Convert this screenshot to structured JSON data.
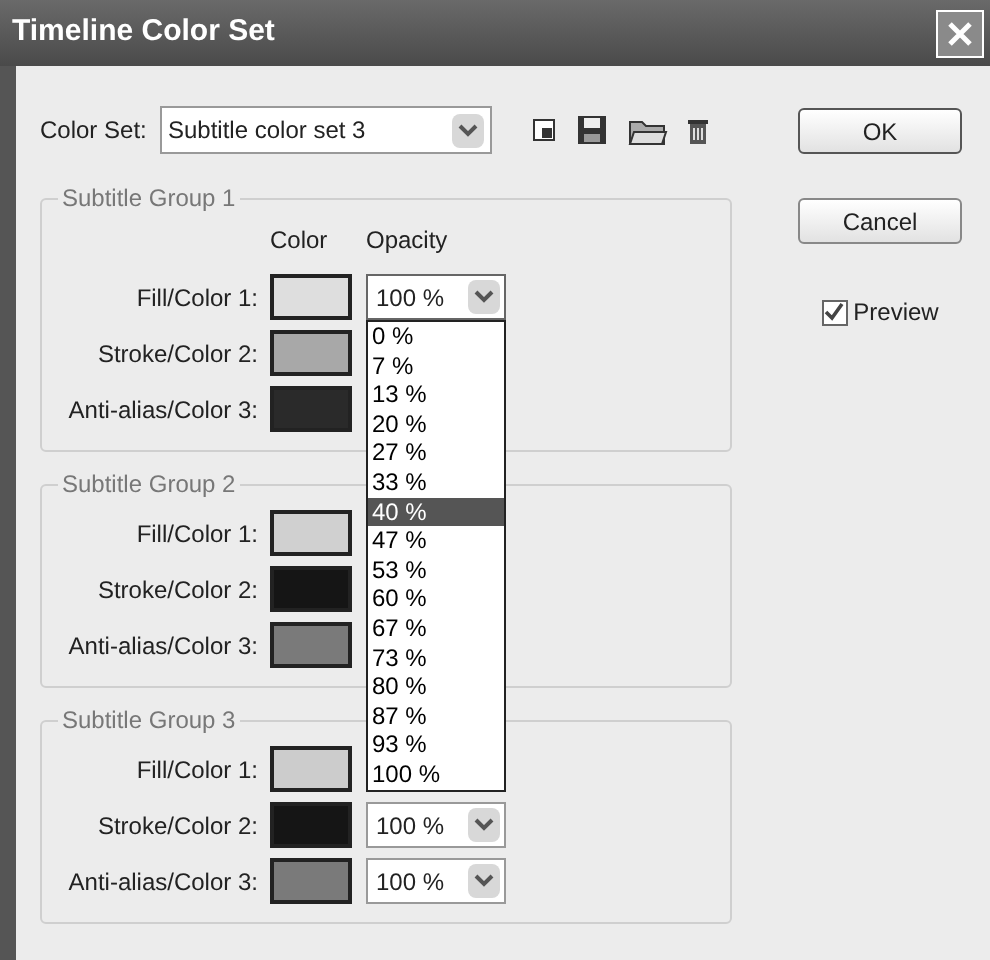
{
  "window": {
    "title": "Timeline Color Set"
  },
  "color_set": {
    "label": "Color Set:",
    "value": "Subtitle color set 3"
  },
  "buttons": [
    {
      "label": "OK",
      "kind": "default"
    },
    {
      "label": "Cancel",
      "kind": "normal"
    }
  ],
  "preview": {
    "label": "Preview",
    "checked": true
  },
  "headers": {
    "swatch_column": "Color",
    "opacity_column": "Opacity"
  },
  "groups": [
    {
      "title": "Subtitle Group 1",
      "rows": [
        {
          "label": "Fill/Color 1:",
          "color": "#dedede",
          "opacity": "100 %",
          "open": true
        },
        {
          "label": "Stroke/Color 2:",
          "color": "#a8a8a8"
        },
        {
          "label": "Anti-alias/Color 3:",
          "color": "#2a2a2a"
        }
      ]
    },
    {
      "title": "Subtitle Group 2",
      "rows": [
        {
          "label": "Fill/Color 1:",
          "color": "#d0d0d0"
        },
        {
          "label": "Stroke/Color 2:",
          "color": "#151515"
        },
        {
          "label": "Anti-alias/Color 3:",
          "color": "#7a7a7a"
        }
      ]
    },
    {
      "title": "Subtitle Group 3",
      "rows": [
        {
          "label": "Fill/Color 1:",
          "color": "#cccccc"
        },
        {
          "label": "Stroke/Color 2:",
          "color": "#151515",
          "opacity": "100 %",
          "open": false
        },
        {
          "label": "Anti-alias/Color 3:",
          "color": "#7a7a7a",
          "opacity": "100 %",
          "open": false
        }
      ]
    }
  ],
  "opacity_options": [
    {
      "label": "0 %",
      "selected": false
    },
    {
      "label": "7 %",
      "selected": false
    },
    {
      "label": "13 %",
      "selected": false
    },
    {
      "label": "20 %",
      "selected": false
    },
    {
      "label": "27 %",
      "selected": false
    },
    {
      "label": "33 %",
      "selected": false
    },
    {
      "label": "40 %",
      "selected": true
    },
    {
      "label": "47 %",
      "selected": false
    },
    {
      "label": "53 %",
      "selected": false
    },
    {
      "label": "60 %",
      "selected": false
    },
    {
      "label": "67 %",
      "selected": false
    },
    {
      "label": "73 %",
      "selected": false
    },
    {
      "label": "80 %",
      "selected": false
    },
    {
      "label": "87 %",
      "selected": false
    },
    {
      "label": "93 %",
      "selected": false
    },
    {
      "label": "100 %",
      "selected": false
    }
  ]
}
